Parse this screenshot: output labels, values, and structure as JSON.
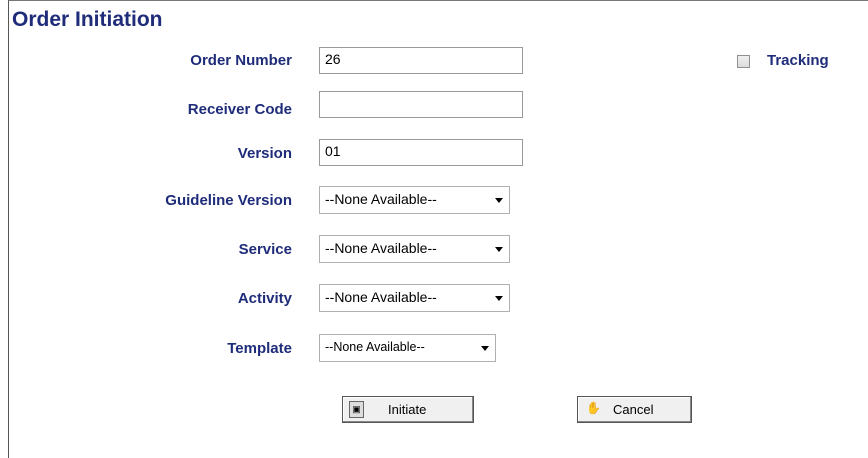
{
  "title": "Order Initiation",
  "fields": {
    "order_number": {
      "label": "Order Number",
      "value": "26"
    },
    "receiver_code": {
      "label": "Receiver Code",
      "value": ""
    },
    "version": {
      "label": "Version",
      "value": "01"
    },
    "guideline_version": {
      "label": "Guideline Version",
      "selected": "--None Available--"
    },
    "service": {
      "label": "Service",
      "selected": "--None Available--"
    },
    "activity": {
      "label": "Activity",
      "selected": "--None Available--"
    },
    "template": {
      "label": "Template",
      "selected": "--None Available--"
    }
  },
  "tracking": {
    "label": "Tracking",
    "checked": false
  },
  "buttons": {
    "initiate": {
      "label": "Initiate",
      "icon": "initiate-icon"
    },
    "cancel": {
      "label": "Cancel",
      "icon": "hand-icon"
    }
  }
}
